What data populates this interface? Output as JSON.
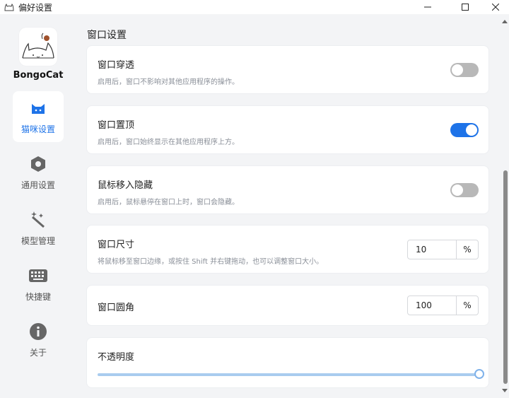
{
  "window": {
    "title": "偏好设置"
  },
  "sidebar": {
    "brand": "BongoCat",
    "items": [
      {
        "label": "猫咪设置",
        "icon": "cat-icon",
        "active": true
      },
      {
        "label": "通用设置",
        "icon": "gear-icon",
        "active": false
      },
      {
        "label": "模型管理",
        "icon": "magic-wand-icon",
        "active": false
      },
      {
        "label": "快捷键",
        "icon": "keyboard-icon",
        "active": false
      },
      {
        "label": "关于",
        "icon": "info-icon",
        "active": false
      }
    ]
  },
  "main": {
    "section_title": "窗口设置",
    "settings": [
      {
        "title": "窗口穿透",
        "desc": "启用后，窗口不影响对其他应用程序的操作。",
        "control": "toggle",
        "value": false
      },
      {
        "title": "窗口置顶",
        "desc": "启用后，窗口始终显示在其他应用程序上方。",
        "control": "toggle",
        "value": true
      },
      {
        "title": "鼠标移入隐藏",
        "desc": "启用后，鼠标悬停在窗口上时，窗口会隐藏。",
        "control": "toggle",
        "value": false
      },
      {
        "title": "窗口尺寸",
        "desc": "将鼠标移至窗口边缘，或按住 Shift 并右键拖动，也可以调整窗口大小。",
        "control": "number",
        "value": "10",
        "unit": "%"
      },
      {
        "title": "窗口圆角",
        "desc": "",
        "control": "number",
        "value": "100",
        "unit": "%"
      },
      {
        "title": "不透明度",
        "desc": "",
        "control": "slider",
        "value": 1.0
      }
    ]
  },
  "colors": {
    "accent": "#1e73e8",
    "toggle_off": "#b8b8b8",
    "slider": "#a9ccef"
  }
}
